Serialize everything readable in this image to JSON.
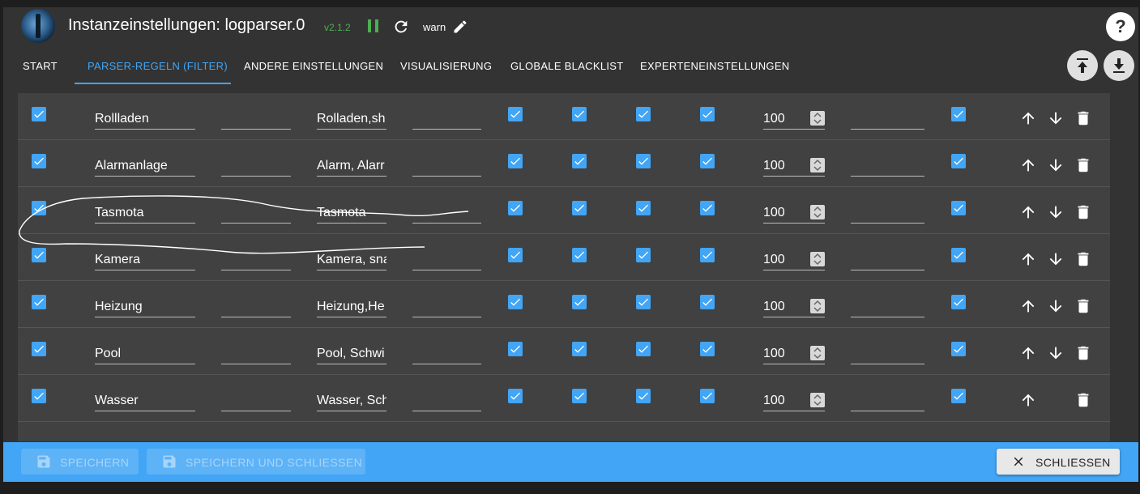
{
  "header": {
    "title": "Instanzeinstellungen: logparser.0",
    "version": "v2.1.2",
    "log_level": "warn",
    "icons": [
      "pause-icon",
      "reload-icon",
      "edit-icon",
      "help-icon"
    ]
  },
  "tabs": [
    {
      "label": "START",
      "active": false
    },
    {
      "label": "PARSER-REGELN (FILTER)",
      "active": true
    },
    {
      "label": "ANDERE EINSTELLUNGEN",
      "active": false
    },
    {
      "label": "VISUALISIERUNG",
      "active": false
    },
    {
      "label": "GLOBALE BLACKLIST",
      "active": false
    },
    {
      "label": "EXPERTENEINSTELLUNGEN",
      "active": false
    }
  ],
  "toolbar": {
    "upload_icon": "upload-icon",
    "download_icon": "download-icon"
  },
  "rules": [
    {
      "active": true,
      "name": "Rollladen",
      "field2": "",
      "filter": "Rolladen,sh",
      "field4": "",
      "c1": true,
      "c2": true,
      "c3": true,
      "c4": true,
      "number": "100",
      "field6": "",
      "c5": true,
      "up": true,
      "down": true
    },
    {
      "active": true,
      "name": "Alarmanlage",
      "field2": "",
      "filter": "Alarm, Alarr",
      "field4": "",
      "c1": true,
      "c2": true,
      "c3": true,
      "c4": true,
      "number": "100",
      "field6": "",
      "c5": true,
      "up": true,
      "down": true
    },
    {
      "active": true,
      "name": "Tasmota",
      "field2": "",
      "filter": "Tasmota",
      "field4": "",
      "c1": true,
      "c2": true,
      "c3": true,
      "c4": true,
      "number": "100",
      "field6": "",
      "c5": true,
      "up": true,
      "down": true
    },
    {
      "active": true,
      "name": "Kamera",
      "field2": "",
      "filter": "Kamera, sna",
      "field4": "",
      "c1": true,
      "c2": true,
      "c3": true,
      "c4": true,
      "number": "100",
      "field6": "",
      "c5": true,
      "up": true,
      "down": true
    },
    {
      "active": true,
      "name": "Heizung",
      "field2": "",
      "filter": "Heizung,He",
      "field4": "",
      "c1": true,
      "c2": true,
      "c3": true,
      "c4": true,
      "number": "100",
      "field6": "",
      "c5": true,
      "up": true,
      "down": true
    },
    {
      "active": true,
      "name": "Pool",
      "field2": "",
      "filter": "Pool, Schwi",
      "field4": "",
      "c1": true,
      "c2": true,
      "c3": true,
      "c4": true,
      "number": "100",
      "field6": "",
      "c5": true,
      "up": true,
      "down": true
    },
    {
      "active": true,
      "name": "Wasser",
      "field2": "",
      "filter": "Wasser, Sch",
      "field4": "",
      "c1": true,
      "c2": true,
      "c3": true,
      "c4": true,
      "number": "100",
      "field6": "",
      "c5": true,
      "up": true,
      "down": false
    }
  ],
  "footer": {
    "save_label": "SPEICHERN",
    "save_close_label": "SPEICHERN UND SCHLIESSEN",
    "close_label": "SCHLIESSEN"
  },
  "colors": {
    "accent": "#42a5f5",
    "running": "#4caf50",
    "background": "#333333",
    "table": "#414141"
  }
}
